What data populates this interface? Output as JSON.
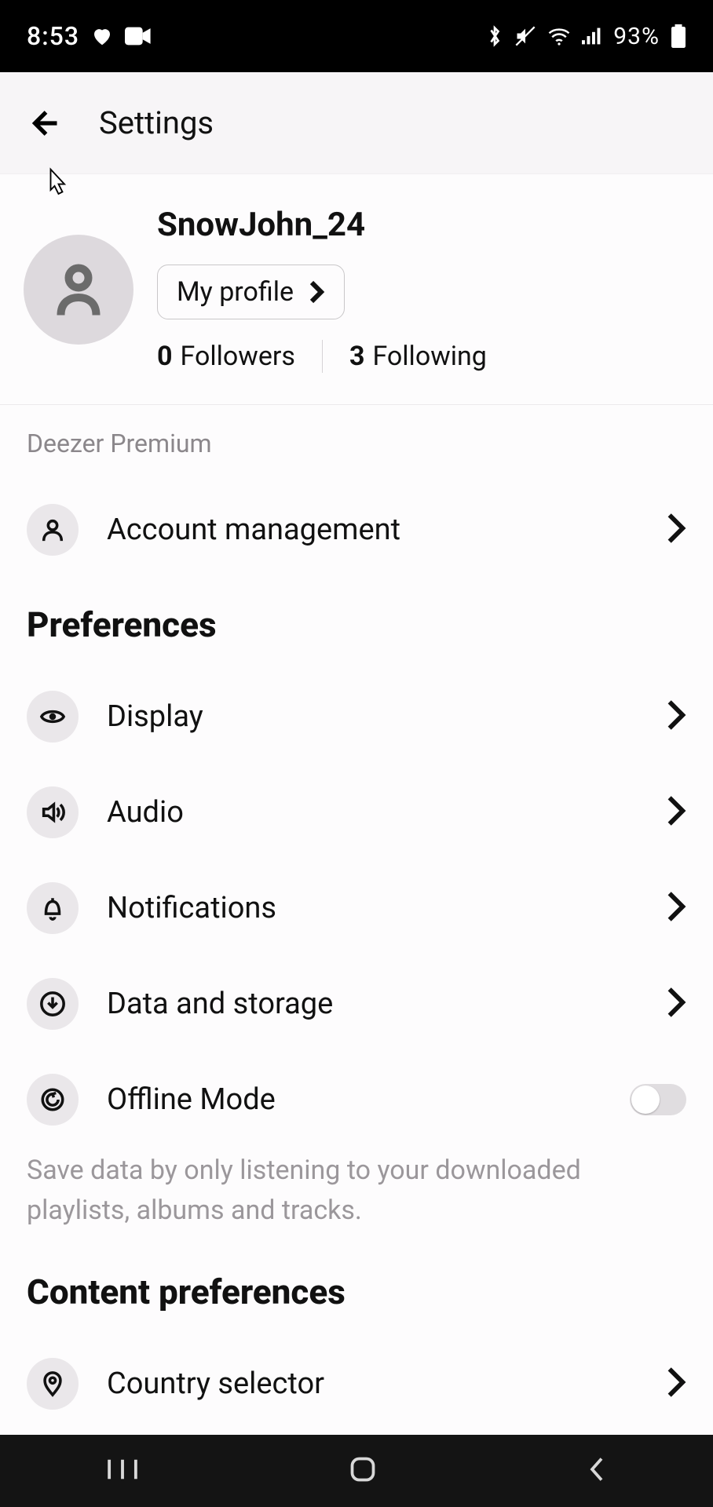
{
  "status": {
    "time": "8:53",
    "battery_pct": "93%"
  },
  "header": {
    "title": "Settings"
  },
  "profile": {
    "username": "SnowJohn_24",
    "button_label": "My profile",
    "followers_count": "0",
    "followers_label": "Followers",
    "following_count": "3",
    "following_label": "Following"
  },
  "plan": {
    "label": "Deezer Premium",
    "account_management": "Account management"
  },
  "preferences": {
    "heading": "Preferences",
    "display": "Display",
    "audio": "Audio",
    "notifications": "Notifications",
    "data_storage": "Data and storage",
    "offline_mode": "Offline Mode",
    "offline_desc": "Save data by only listening to your downloaded playlists, albums and tracks."
  },
  "content_prefs": {
    "heading": "Content preferences",
    "country_selector": "Country selector"
  }
}
